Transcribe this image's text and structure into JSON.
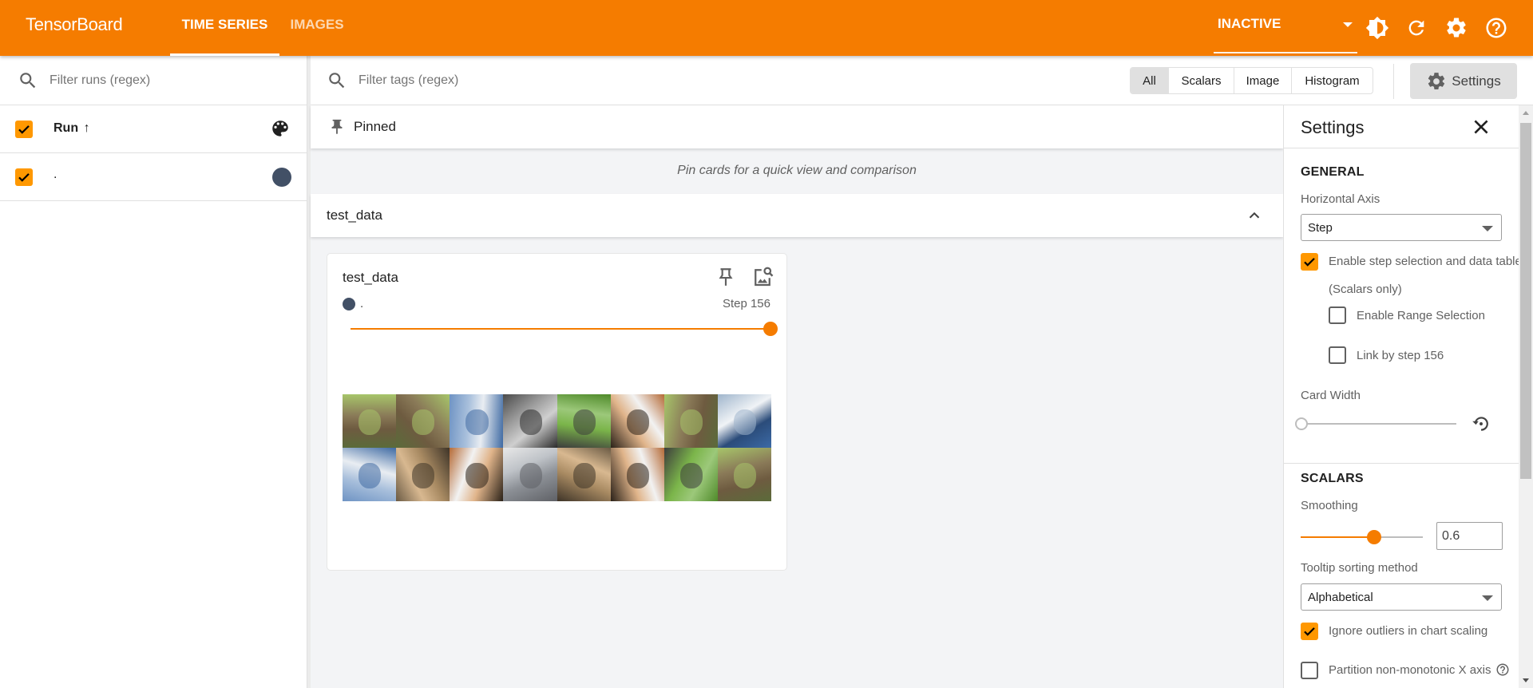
{
  "header": {
    "brand": "TensorBoard",
    "tabs": [
      {
        "label": "TIME SERIES",
        "active": true
      },
      {
        "label": "IMAGES",
        "active": false
      }
    ],
    "plugin_selector": "INACTIVE",
    "icons": [
      "theme-toggle-icon",
      "reload-icon",
      "settings-gear-icon",
      "help-icon"
    ],
    "accent_color": "#F57C00"
  },
  "sidebar": {
    "filter_placeholder": "Filter runs (regex)",
    "column_header": "Run",
    "sort_indicator": "↑",
    "runs": [
      {
        "name": ".",
        "checked": true,
        "color": "#425066"
      }
    ]
  },
  "toolbar": {
    "filter_placeholder": "Filter tags (regex)",
    "type_filters": [
      {
        "label": "All",
        "selected": true
      },
      {
        "label": "Scalars",
        "selected": false
      },
      {
        "label": "Image",
        "selected": false
      },
      {
        "label": "Histogram",
        "selected": false
      }
    ],
    "settings_label": "Settings"
  },
  "pinned": {
    "title": "Pinned",
    "empty_message": "Pin cards for a quick view and comparison"
  },
  "group": {
    "title": "test_data",
    "collapsed": false
  },
  "card": {
    "title": "test_data",
    "run_name": ".",
    "run_color": "#425066",
    "step_label": "Step 156",
    "step_slider_fraction": 1.0,
    "images": [
      "deer",
      "deer",
      "airplane",
      "automobile",
      "bird",
      "dog",
      "deer",
      "ship",
      "airplane",
      "cat",
      "dog",
      "truck",
      "cat",
      "dog",
      "bird",
      "deer"
    ]
  },
  "settings": {
    "title": "Settings",
    "general": {
      "section_title": "GENERAL",
      "horizontal_axis_label": "Horizontal Axis",
      "horizontal_axis_value": "Step",
      "step_selection_label": "Enable step selection and data table",
      "step_selection_checked": true,
      "scalars_only_note": "(Scalars only)",
      "range_selection_label": "Enable Range Selection",
      "range_selection_checked": false,
      "link_by_step_label": "Link by step 156",
      "link_by_step_checked": false,
      "card_width_label": "Card Width",
      "card_width_fraction": 0.0
    },
    "scalars": {
      "section_title": "SCALARS",
      "smoothing_label": "Smoothing",
      "smoothing_value": "0.6",
      "smoothing_fraction": 0.6,
      "tooltip_sort_label": "Tooltip sorting method",
      "tooltip_sort_value": "Alphabetical",
      "ignore_outliers_label": "Ignore outliers in chart scaling",
      "ignore_outliers_checked": true,
      "partition_label": "Partition non-monotonic X axis",
      "partition_checked": false
    }
  }
}
